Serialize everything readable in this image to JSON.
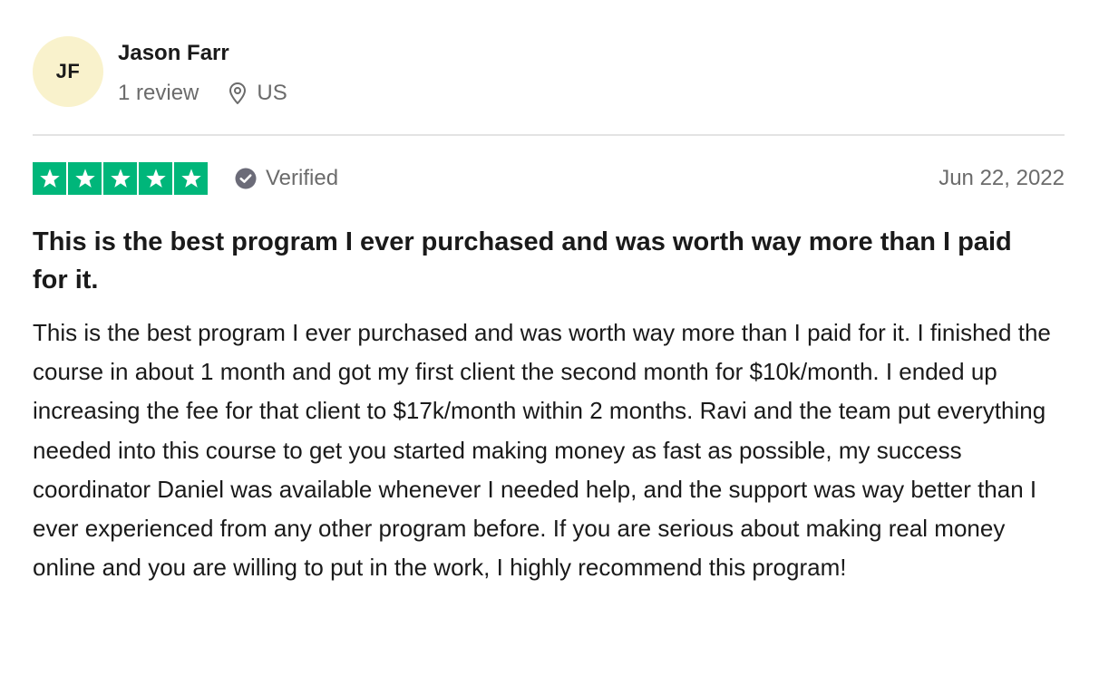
{
  "author": {
    "initials": "JF",
    "name": "Jason Farr",
    "review_count": "1 review",
    "location": "US",
    "avatar_color": "#f9f2cc"
  },
  "review": {
    "rating": 5,
    "rating_max": 5,
    "star_color": "#00b67a",
    "verified_label": "Verified",
    "date": "Jun 22, 2022",
    "title": "This is the best program I ever purchased and was worth way more than I paid for it.",
    "body": "This is the best program I ever purchased and was worth way more than I paid for it. I finished the course in about 1 month and got my first client the second month for $10k/month. I ended up increasing the fee for that client to $17k/month within 2 months. Ravi and the team put everything needed into this course to get you started making money as fast as possible, my success coordinator Daniel was available whenever I needed help, and the support was way better than I ever experienced from any other program before. If you are serious about making real money online and you are willing to put in the work, I highly recommend this program!"
  },
  "icons": {
    "location": "location-pin-icon",
    "verified": "verified-check-icon",
    "star": "star-icon"
  }
}
